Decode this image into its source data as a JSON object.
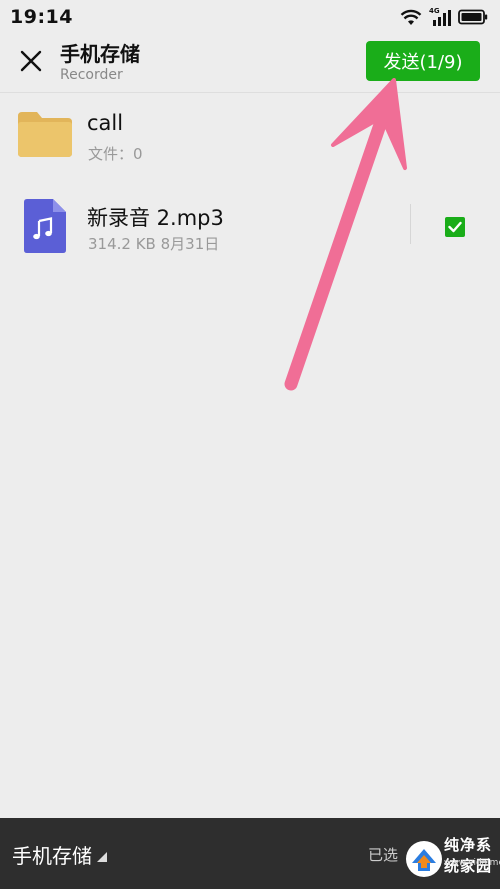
{
  "status_bar": {
    "time": "19:14",
    "network_label": "4G",
    "icons": [
      "wifi-icon",
      "cellular-signal-icon",
      "battery-icon"
    ]
  },
  "header": {
    "title": "手机存储",
    "subtitle": "Recorder",
    "close_icon": "close-icon",
    "send_label": "发送(1/9)"
  },
  "files": [
    {
      "name": "call",
      "meta": "文件：0",
      "icon": "folder-icon",
      "type": "folder"
    },
    {
      "name": "新录音 2.mp3",
      "meta": "314.2 KB   8月31日",
      "icon": "audio-file-icon",
      "type": "audio",
      "checked": true
    }
  ],
  "bottom_bar": {
    "storage_label": "手机存储",
    "selected_info": "已选"
  },
  "watermark": {
    "main": "纯净系统家园",
    "url": "www.yidaimei.com"
  },
  "colors": {
    "accent": "#1aad19",
    "background": "#ededed",
    "bottom_bar": "#2e2e2e",
    "folder": "#e8c068",
    "audio_file": "#5b5fd6",
    "annotation_arrow": "#f06e96"
  }
}
